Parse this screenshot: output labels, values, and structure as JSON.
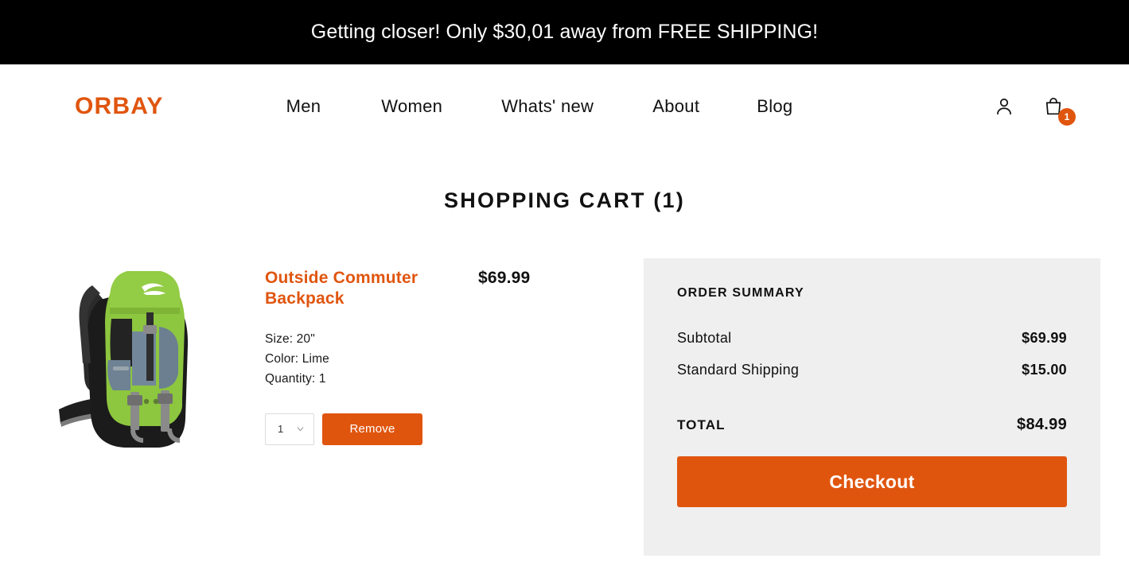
{
  "promo": {
    "message": "Getting closer! Only $30,01 away from FREE SHIPPING!"
  },
  "header": {
    "logo": "ORBAY",
    "nav": [
      {
        "label": "Men"
      },
      {
        "label": "Women"
      },
      {
        "label": "Whats' new"
      },
      {
        "label": "About"
      },
      {
        "label": "Blog"
      }
    ],
    "account_icon": "user-icon",
    "cart_icon": "shopping-bag-icon",
    "cart_count": "1"
  },
  "page": {
    "title": "SHOPPING CART (1)"
  },
  "product": {
    "name": "Outside Commuter Backpack",
    "price": "$69.99",
    "image_alt": "lime green hiking backpack",
    "attributes": [
      {
        "text": "Size: 20\""
      },
      {
        "text": "Color: Lime"
      },
      {
        "text": "Quantity: 1"
      }
    ],
    "quantity_value": "1",
    "remove_label": "Remove"
  },
  "summary": {
    "title": "ORDER SUMMARY",
    "rows": [
      {
        "label": "Subtotal",
        "value": "$69.99"
      },
      {
        "label": "Standard Shipping",
        "value": "$15.00"
      }
    ],
    "total_label": "TOTAL",
    "total_value": "$84.99",
    "checkout_label": "Checkout"
  },
  "colors": {
    "brand_orange": "#E0550E",
    "banner_black": "#000000",
    "summary_bg": "#EFEFEF",
    "product_lime": "#8DC63F"
  }
}
